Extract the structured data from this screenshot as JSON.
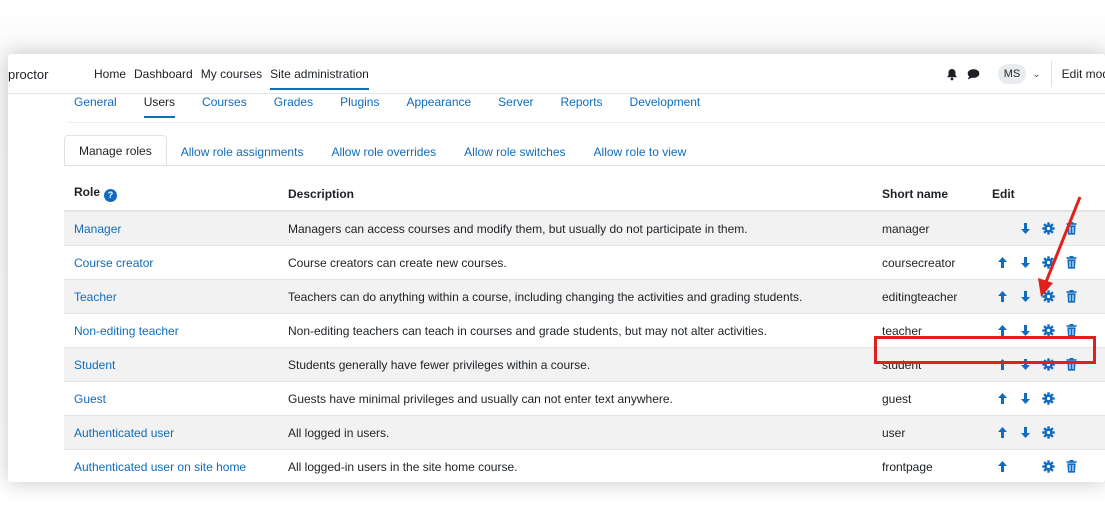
{
  "navbar": {
    "brand": "proctor",
    "items": [
      {
        "label": "Home"
      },
      {
        "label": "Dashboard"
      },
      {
        "label": "My courses"
      },
      {
        "label": "Site administration"
      }
    ],
    "user_initials": "MS",
    "edit_mode_label": "Edit mod"
  },
  "secondary_nav": {
    "items": [
      {
        "label": "General"
      },
      {
        "label": "Users"
      },
      {
        "label": "Courses"
      },
      {
        "label": "Grades"
      },
      {
        "label": "Plugins"
      },
      {
        "label": "Appearance"
      },
      {
        "label": "Server"
      },
      {
        "label": "Reports"
      },
      {
        "label": "Development"
      }
    ],
    "active": "Users"
  },
  "tabs": [
    {
      "label": "Manage roles"
    },
    {
      "label": "Allow role assignments"
    },
    {
      "label": "Allow role overrides"
    },
    {
      "label": "Allow role switches"
    },
    {
      "label": "Allow role to view"
    }
  ],
  "table": {
    "headers": {
      "role": "Role",
      "description": "Description",
      "short_name": "Short name",
      "edit": "Edit"
    },
    "rows": [
      {
        "role": "Manager",
        "description": "Managers can access courses and modify them, but usually do not participate in them.",
        "short_name": "manager",
        "actions": [
          "down",
          "settings",
          "delete"
        ]
      },
      {
        "role": "Course creator",
        "description": "Course creators can create new courses.",
        "short_name": "coursecreator",
        "actions": [
          "up",
          "down",
          "settings",
          "delete"
        ]
      },
      {
        "role": "Teacher",
        "description": "Teachers can do anything within a course, including changing the activities and grading students.",
        "short_name": "editingteacher",
        "actions": [
          "up",
          "down",
          "settings",
          "delete"
        ]
      },
      {
        "role": "Non-editing teacher",
        "description": "Non-editing teachers can teach in courses and grade students, but may not alter activities.",
        "short_name": "teacher",
        "actions": [
          "up",
          "down",
          "settings",
          "delete"
        ]
      },
      {
        "role": "Student",
        "description": "Students generally have fewer privileges within a course.",
        "short_name": "student",
        "actions": [
          "up",
          "down",
          "settings",
          "delete"
        ]
      },
      {
        "role": "Guest",
        "description": "Guests have minimal privileges and usually can not enter text anywhere.",
        "short_name": "guest",
        "actions": [
          "up",
          "down",
          "settings"
        ]
      },
      {
        "role": "Authenticated user",
        "description": "All logged in users.",
        "short_name": "user",
        "actions": [
          "up",
          "down",
          "settings"
        ]
      },
      {
        "role": "Authenticated user on site home",
        "description": "All logged-in users in the site home course.",
        "short_name": "frontpage",
        "actions": [
          "up",
          "settings",
          "delete"
        ]
      }
    ]
  },
  "colors": {
    "link": "#0f6cbf",
    "annotation": "#e0201c",
    "row_stripe": "#f2f2f2"
  }
}
